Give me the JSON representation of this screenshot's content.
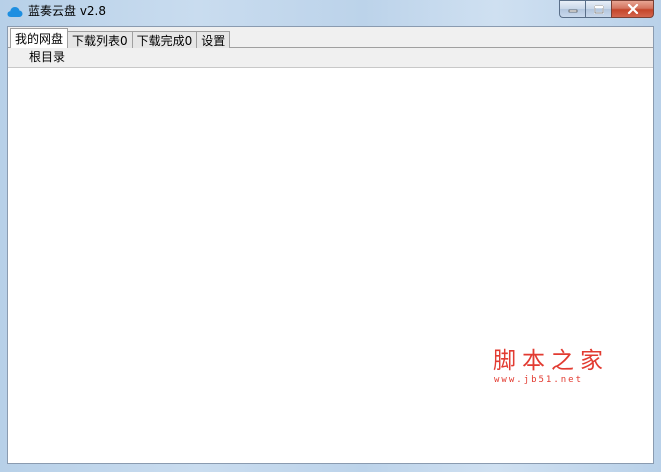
{
  "window": {
    "title": "蓝奏云盘 v2.8",
    "icon": "cloud-icon",
    "controls": {
      "minimize": "minimize-icon",
      "maximize": "maximize-icon",
      "close": "close-icon"
    },
    "colors": {
      "accent": "#1e8fe1",
      "close": "#c4452a"
    }
  },
  "tabs": [
    {
      "label": "我的网盘"
    },
    {
      "label": "下载列表0"
    },
    {
      "label": "下载完成0"
    },
    {
      "label": "设置"
    }
  ],
  "path": {
    "current": "根目录"
  },
  "watermark": {
    "main": "脚本之家",
    "sub": "www.jb51.net",
    "color": "#e23b31"
  }
}
